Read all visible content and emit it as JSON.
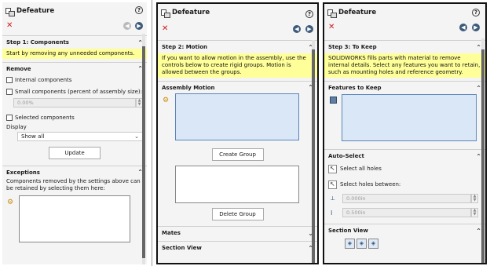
{
  "panel1": {
    "title": "Defeature",
    "step_title": "Step 1: Components",
    "step_msg": "Start by removing any unneeded components.",
    "remove_head": "Remove",
    "internal_components": "Internal components",
    "small_components": "Small components (percent of assembly size):",
    "small_value": "0.00%",
    "selected_components": "Selected components",
    "display_label": "Display",
    "display_value": "Show all",
    "update_label": "Update",
    "exceptions_head": "Exceptions",
    "exceptions_text": "Components removed by the settings above can be retained by selecting them here:"
  },
  "panel2": {
    "title": "Defeature",
    "step_title": "Step 2: Motion",
    "step_msg": "If you want to allow motion in the assembly, use the controls below to create rigid groups. Motion is allowed between the groups.",
    "assembly_motion_head": "Assembly Motion",
    "create_group_label": "Create Group",
    "delete_group_label": "Delete Group",
    "mates_head": "Mates",
    "section_view_head": "Section View"
  },
  "panel3": {
    "title": "Defeature",
    "step_title": "Step 3: To Keep",
    "step_msg": "SOLIDWORKS fills parts with material to remove internal details. Select any features you want to retain, such as mounting holes and reference geometry.",
    "features_head": "Features to Keep",
    "auto_select_head": "Auto-Select",
    "select_all_holes": "Select all holes",
    "select_holes_between": "Select holes between:",
    "min_value": "0.000in",
    "max_value": "0.500in",
    "section_view_head": "Section View"
  },
  "colors": {
    "message_bg": "#ffff99",
    "selection_box": "#d9e7f7",
    "close_x": "#d21c1c",
    "nav_enabled": "#3d5a7a"
  }
}
